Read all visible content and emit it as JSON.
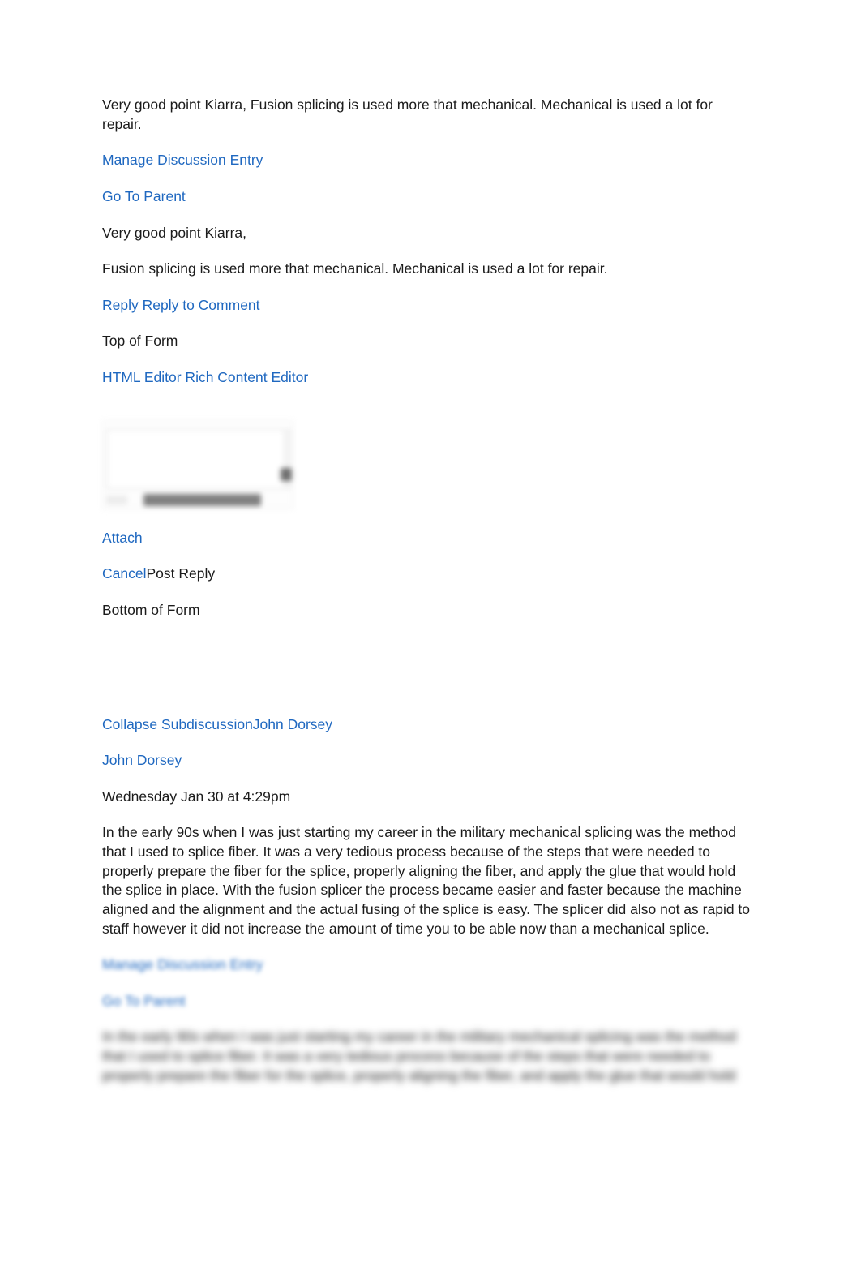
{
  "entry_top": {
    "summary_text": "Very good point Kiarra, Fusion splicing is used more that mechanical. Mechanical is used a lot for repair.",
    "manage_link": "Manage Discussion Entry",
    "parent_link": "Go To Parent",
    "body_line_1": "Very good point Kiarra,",
    "body_line_2": "Fusion splicing is used more that mechanical. Mechanical is used a lot for repair.",
    "reply_link": "Reply Reply to Comment"
  },
  "reply_form": {
    "top_of_form": "Top of Form",
    "editor_toggle_link": "HTML Editor Rich Content Editor",
    "attach_link": "Attach",
    "cancel_link": "Cancel",
    "post_reply_label": "Post Reply",
    "bottom_of_form": "Bottom of Form"
  },
  "entry_dorsey": {
    "collapse_link": "Collapse SubdiscussionJohn Dorsey",
    "author_link": "John Dorsey",
    "timestamp": "Wednesday Jan 30 at 4:29pm",
    "message": "In the early 90s when I was just starting my career in the military mechanical splicing was the method that I used to splice fiber. It was a very tedious process because of the steps that were needed to properly prepare the fiber for the splice, properly aligning the fiber, and apply the glue that would hold the splice in place. With the fusion splicer the process became easier and faster because the machine aligned and the alignment and the actual fusing of the splice is easy. The splicer did also not as rapid to staff however it did not increase the amount of time you to be able now than a mechanical splice.",
    "manage_link": "Manage Discussion Entry",
    "parent_link": "Go To Parent",
    "message_repeat": "In the early 90s when I was just starting my career in the military mechanical splicing was the method that I used to splice fiber. It was a very tedious process because of the steps that were needed to properly prepare the fiber for the splice, properly aligning the fiber, and apply the glue that would hold"
  },
  "colors": {
    "link": "#1f68c0",
    "text": "#1b1b1b",
    "background": "#ffffff"
  }
}
